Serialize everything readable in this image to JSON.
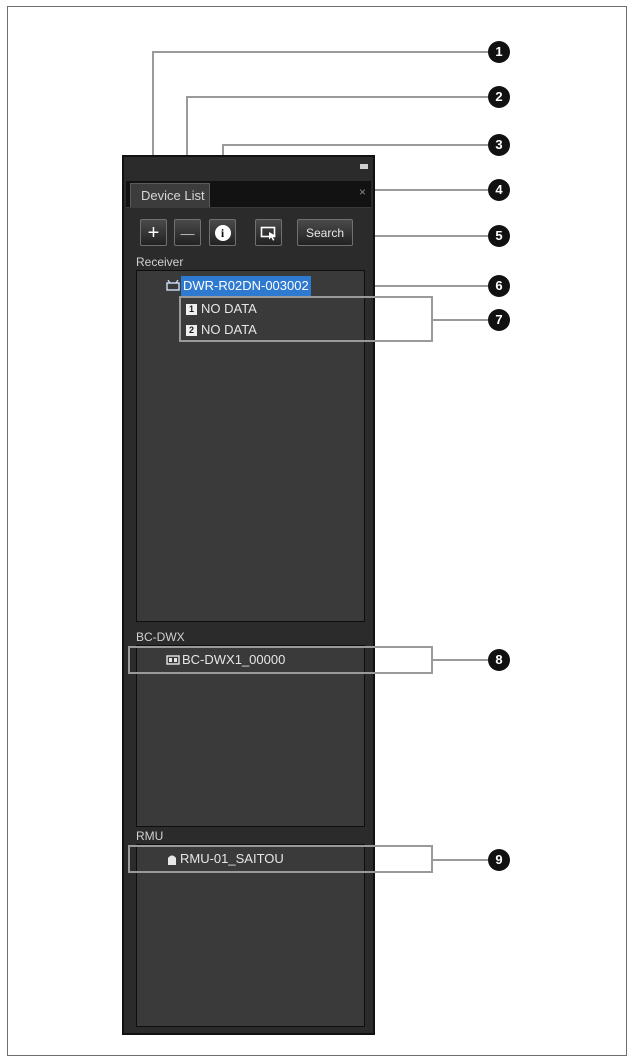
{
  "window": {
    "tab_label": "Device List",
    "close_glyph": "×"
  },
  "toolbar": {
    "add_glyph": "+",
    "remove_glyph": "—",
    "info_glyph": "i",
    "search_label": "Search"
  },
  "sections": {
    "receiver": {
      "label": "Receiver",
      "device": {
        "name": "DWR-R02DN-003002",
        "icon": "receiver-icon"
      },
      "channels": [
        {
          "badge": "1",
          "label": "NO DATA"
        },
        {
          "badge": "2",
          "label": "NO DATA"
        }
      ]
    },
    "bcdwx": {
      "label": "BC-DWX",
      "device": {
        "name": "BC-DWX1_00000",
        "icon": "charger-icon"
      }
    },
    "rmu": {
      "label": "RMU",
      "device": {
        "name": "RMU-01_SAITOU",
        "icon": "rmu-icon"
      }
    }
  },
  "callouts": [
    "1",
    "2",
    "3",
    "4",
    "5",
    "6",
    "7",
    "8",
    "9"
  ]
}
